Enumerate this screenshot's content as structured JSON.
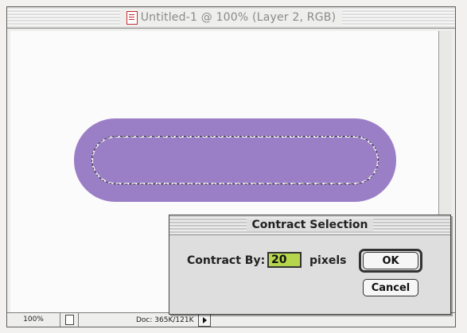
{
  "window": {
    "title": "Untitled-1 @ 100% (Layer 2, RGB)",
    "icon": "document-icon"
  },
  "canvas": {
    "shape_color": "#9b7fc6",
    "background": "#fbfbfc"
  },
  "status_bar": {
    "zoom": "100%",
    "doc_info": "Doc: 365K/121K"
  },
  "dialog": {
    "title": "Contract Selection",
    "field_label": "Contract By:",
    "field_value": "20",
    "unit": "pixels",
    "ok_label": "OK",
    "cancel_label": "Cancel",
    "field_highlight": "#b5d64c"
  }
}
